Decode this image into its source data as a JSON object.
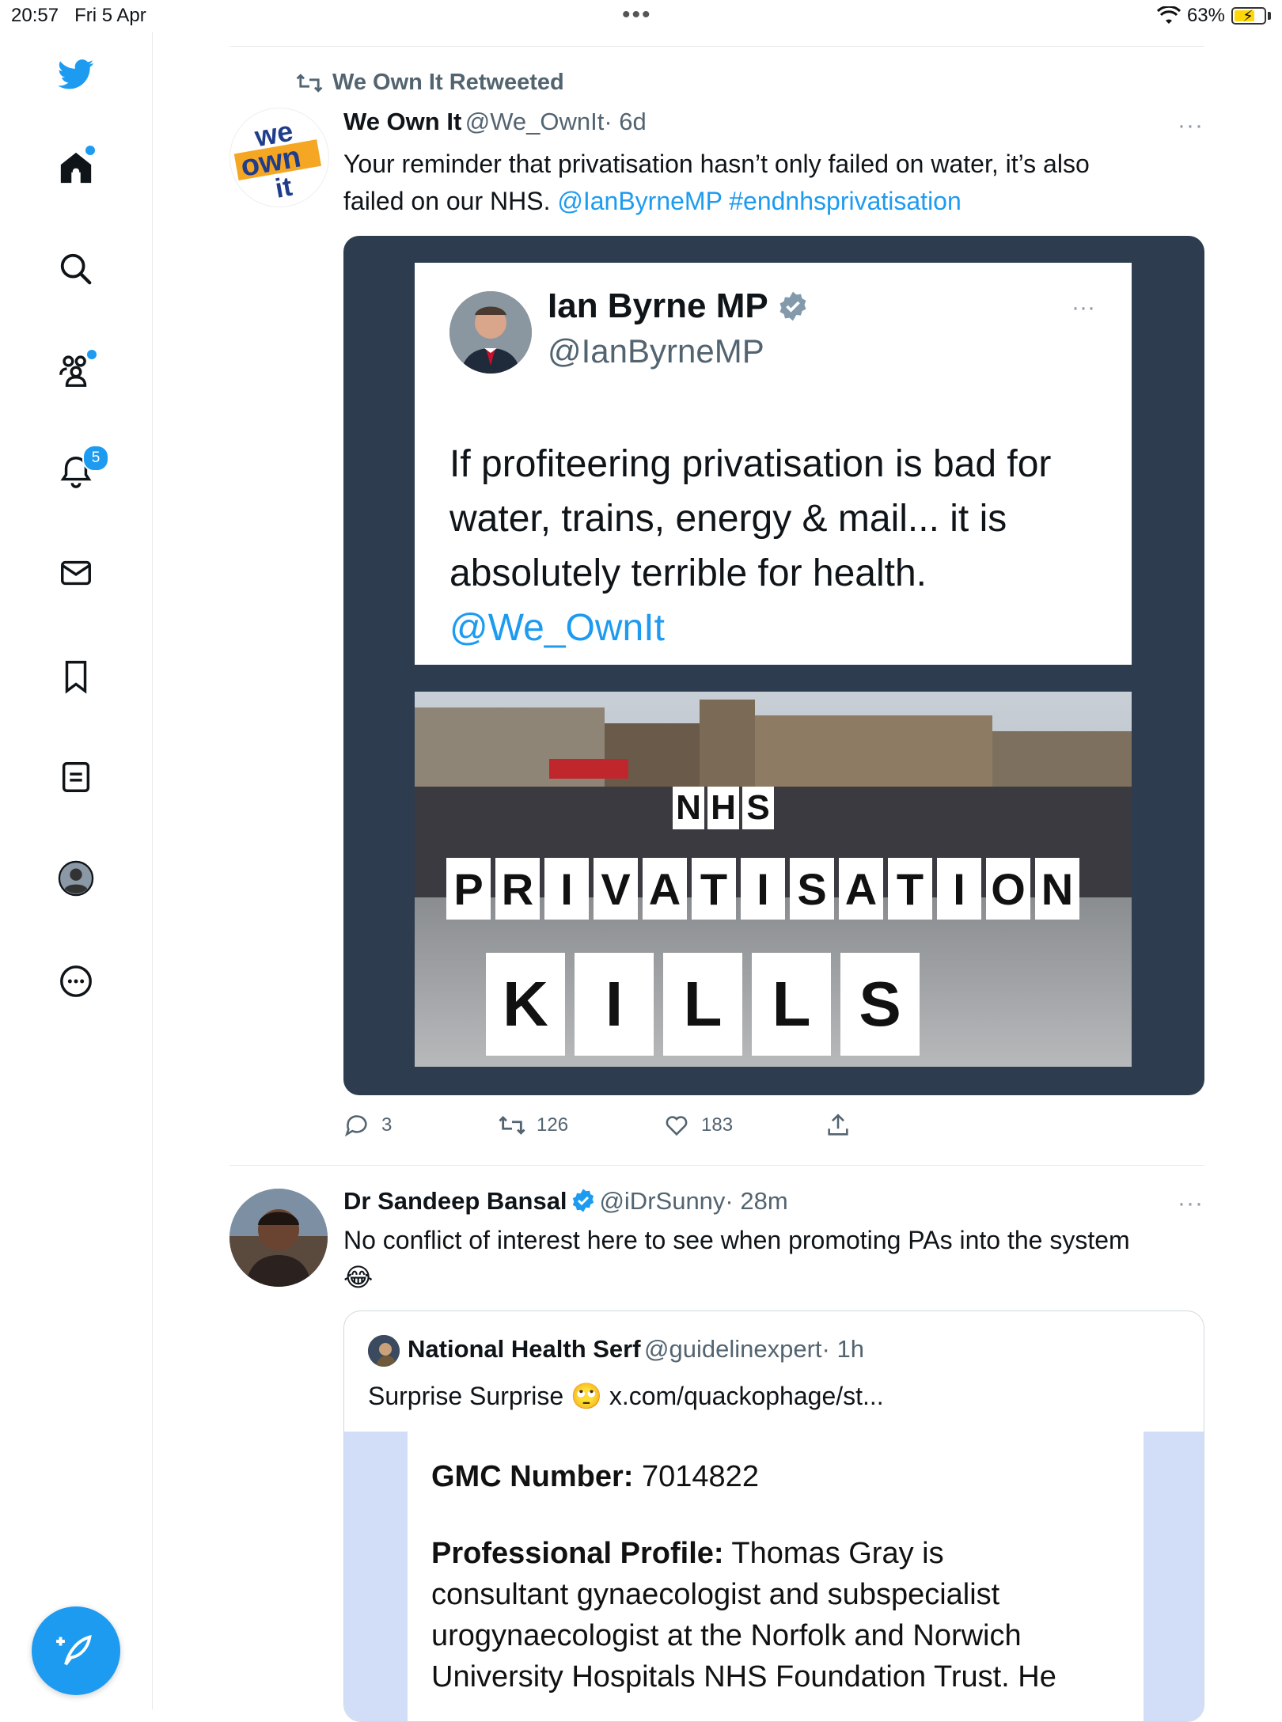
{
  "status_bar": {
    "time": "20:57",
    "date": "Fri 5 Apr",
    "battery": "63%",
    "battery_level": 0.63,
    "menu_dots": "•••"
  },
  "sidebar": {
    "items": [
      {
        "name": "home-icon"
      },
      {
        "name": "search-icon"
      },
      {
        "name": "communities-icon"
      },
      {
        "name": "notifications-icon",
        "badge": "5"
      },
      {
        "name": "messages-icon"
      },
      {
        "name": "bookmarks-icon"
      },
      {
        "name": "lists-icon"
      },
      {
        "name": "profile-icon"
      },
      {
        "name": "more-icon"
      }
    ],
    "compose": "compose-icon",
    "accent": "#1d9bf0"
  },
  "tweet1": {
    "retweet_label": "We Own It Retweeted",
    "avatar_text": [
      "we",
      "own",
      "it"
    ],
    "name": "We Own It",
    "handle": "@We_OwnIt",
    "time": "· 6d",
    "more": "···",
    "text_line1": "Your reminder that privatisation hasn’t only failed on water, it’s also",
    "text_line2": "failed on our NHS.",
    "mention": "@IanByrneMP",
    "hashtag": "#endnhsprivatisation",
    "image": {
      "card_name": "Ian Byrne MP",
      "card_handle": "@IanByrneMP",
      "card_more": "···",
      "card_text_lines": [
        "If profiteering privatisation is bad for",
        "water, trains, energy & mail... it is",
        "absolutely terrible for health."
      ],
      "card_mention": "@We_OwnIt",
      "signs_row1": [
        "N",
        "H",
        "S"
      ],
      "signs_row2": [
        "P",
        "R",
        "I",
        "V",
        "A",
        "T",
        "I",
        "S",
        "A",
        "T",
        "I",
        "O",
        "N"
      ],
      "signs_row3": [
        "K",
        "I",
        "L",
        "L",
        "S"
      ]
    },
    "actions": {
      "replies": "3",
      "retweets": "126",
      "likes": "183"
    }
  },
  "tweet2": {
    "name": "Dr Sandeep Bansal",
    "handle": "@iDrSunny",
    "time": "· 28m",
    "more": "···",
    "text": "No conflict of interest here to see when promoting PAs into the system",
    "emoji": "😂",
    "quote": {
      "name": "National Health Serf",
      "handle": "@guidelinexpert",
      "time": "· 1h",
      "text": "Surprise Surprise",
      "emoji": "🙄",
      "link": "x.com/quackophage/st...",
      "doc_gmc_label": "GMC Number:",
      "doc_gmc_value": "7014822",
      "doc_profile_label": "Professional Profile:",
      "doc_lines": [
        "Thomas Gray is",
        "consultant gynaecologist and subspecialist",
        "urogynaecologist at the Norfolk and Norwich",
        "University Hospitals NHS Foundation Trust. He"
      ]
    }
  }
}
